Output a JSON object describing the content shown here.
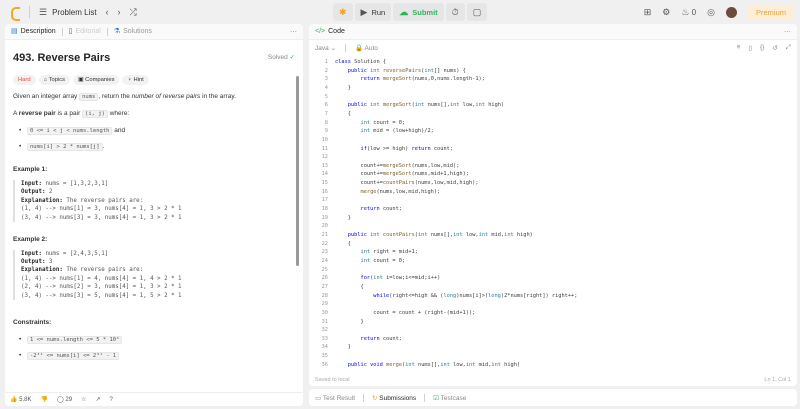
{
  "topbar": {
    "problem_list": "Problem List",
    "run": "Run",
    "submit": "Submit",
    "streak": "0",
    "premium": "Premium"
  },
  "left": {
    "tabs": [
      {
        "label": "Description"
      },
      {
        "label": "Editorial"
      },
      {
        "label": "Solutions"
      }
    ],
    "title": "493. Reverse Pairs",
    "solved": "Solved",
    "chips": [
      "Hard",
      "Topics",
      "Companies",
      "Hint"
    ],
    "intro_a": "Given an integer array ",
    "intro_code": "nums",
    "intro_b": ", return the ",
    "intro_em": "number of reverse pairs",
    "intro_c": " in the array.",
    "def_a": "A ",
    "def_b": "reverse pair",
    "def_c": " is a pair ",
    "def_code": "(i, j)",
    "def_d": " where:",
    "cond1": "0 <= i < j < nums.length",
    "cond1_tail": " and",
    "cond2": "nums[i] > 2 * nums[j]",
    "cond2_tail": ".",
    "ex1_title": "Example 1:",
    "ex1_input_label": "Input:",
    "ex1_input": " nums = [1,3,2,3,1]",
    "ex1_output_label": "Output:",
    "ex1_output": " 2",
    "ex1_expl_label": "Explanation:",
    "ex1_expl": " The reverse pairs are:\n(1, 4) --> nums[1] = 3, nums[4] = 1, 3 > 2 * 1\n(3, 4) --> nums[3] = 3, nums[4] = 1, 3 > 2 * 1",
    "ex2_title": "Example 2:",
    "ex2_input_label": "Input:",
    "ex2_input": " nums = [2,4,3,5,1]",
    "ex2_output_label": "Output:",
    "ex2_output": " 3",
    "ex2_expl_label": "Explanation:",
    "ex2_expl": " The reverse pairs are:\n(1, 4) --> nums[1] = 4, nums[4] = 1, 4 > 2 * 1\n(2, 4) --> nums[2] = 3, nums[4] = 1, 3 > 2 * 1\n(3, 4) --> nums[3] = 5, nums[4] = 1, 5 > 2 * 1",
    "constraints_title": "Constraints:",
    "con1": "1 <= nums.length <= 5 * 10⁴",
    "con2": "-2³¹ <= nums[i] <= 2³¹ - 1",
    "likes": "5.8K",
    "comments": "29"
  },
  "right": {
    "tab": "Code",
    "lang": "Java",
    "mode": "Auto",
    "saved": "Saved to local",
    "cursor": "Ln 1, Col 1",
    "code": [
      "class Solution {",
      "    public int reversePairs(int[] nums) {",
      "        return mergeSort(nums,0,nums.length-1);",
      "    }",
      "",
      "    public int mergeSort(int nums[],int low,int high)",
      "    {",
      "        int count = 0;",
      "        int mid = (low+high)/2;",
      "",
      "        if(low >= high) return count;",
      "",
      "        count+=mergeSort(nums,low,mid);",
      "        count+=mergeSort(nums,mid+1,high);",
      "        count+=countPairs(nums,low,mid,high);",
      "        merge(nums,low,mid,high);",
      "",
      "        return count;",
      "    }",
      "",
      "    public int countPairs(int nums[],int low,int mid,int high)",
      "    {",
      "        int right = mid+1;",
      "        int count = 0;",
      "",
      "        for(int i=low;i<=mid;i++)",
      "        {",
      "            while(right<=high && (long)nums[i]>(long)2*nums[right]) right++;",
      "",
      "            count = count + (right-(mid+1));",
      "        }",
      "",
      "        return count;",
      "    }",
      "",
      "    public void merge(int nums[],int low,int mid,int high)"
    ]
  },
  "bottom": {
    "tabs": [
      {
        "label": "Test Result"
      },
      {
        "label": "Submissions"
      },
      {
        "label": "Testcase"
      }
    ]
  }
}
